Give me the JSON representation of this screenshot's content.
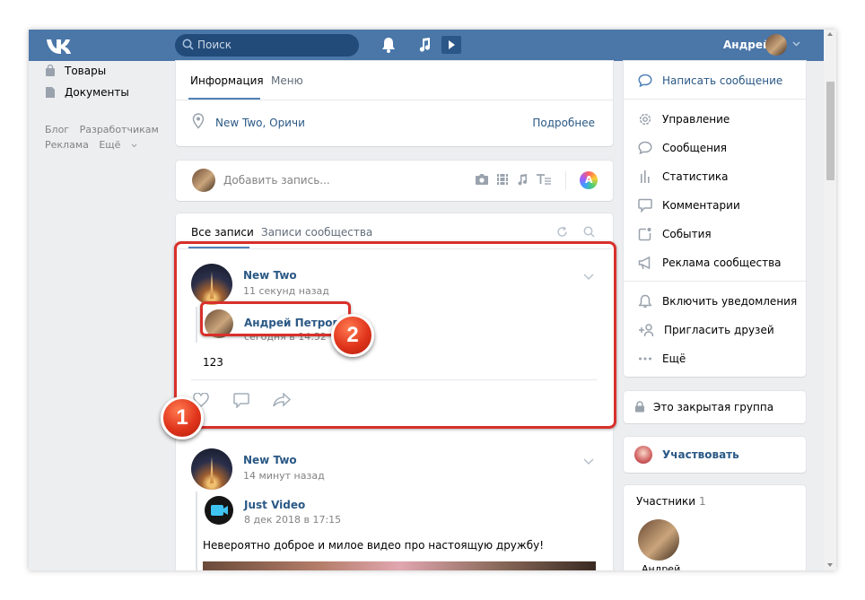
{
  "header": {
    "search_placeholder": "Поиск",
    "user_name": "Андрей",
    "icons": [
      "vk-logo-icon",
      "search-icon",
      "bell-icon",
      "music-icon",
      "video-icon",
      "chevron-down-icon"
    ],
    "bg_color": "#4a76a8"
  },
  "left_menu": {
    "items": [
      {
        "label": "Товары",
        "icon": "bag-icon"
      },
      {
        "label": "Документы",
        "icon": "document-icon"
      }
    ],
    "links": [
      "Блог",
      "Разработчикам",
      "Реклама",
      "Ещё"
    ]
  },
  "info_card": {
    "tabs": [
      "Информация",
      "Меню"
    ],
    "location": "New Two, Оричи",
    "more_link": "Подробнее"
  },
  "post_box": {
    "placeholder": "Добавить запись..."
  },
  "wall": {
    "tabs": [
      "Все записи",
      "Записи сообщества"
    ],
    "posts": [
      {
        "author": "New Two",
        "time": "11 секунд назад",
        "repost_author": "Андрей Петров",
        "repost_time": "сегодня в 14:52",
        "text": "123"
      },
      {
        "author": "New Two",
        "time": "14 минут назад",
        "repost_author": "Just Video",
        "repost_time": "8 дек 2018 в 17:15",
        "text": "Невероятно доброе и милое видео про настоящую дружбу!"
      }
    ]
  },
  "annotations": {
    "badge_1": "1",
    "badge_2": "2",
    "color": "#d8302b"
  },
  "right_actions": {
    "primary": "Написать сообщение",
    "items": [
      {
        "label": "Управление",
        "icon": "gear-icon"
      },
      {
        "label": "Сообщения",
        "icon": "message-icon"
      },
      {
        "label": "Статистика",
        "icon": "stats-icon"
      },
      {
        "label": "Комментарии",
        "icon": "comment-icon"
      },
      {
        "label": "События",
        "icon": "event-icon"
      },
      {
        "label": "Реклама сообщества",
        "icon": "megaphone-icon"
      }
    ],
    "items2": [
      {
        "label": "Включить уведомления",
        "icon": "bell-icon"
      },
      {
        "label": "Пригласить друзей",
        "icon": "add-user-icon"
      },
      {
        "label": "Ещё",
        "icon": "more-icon"
      }
    ]
  },
  "closed_group": "Это закрытая группа",
  "join": "Участвовать",
  "members": {
    "title": "Участники",
    "count": "1",
    "first_name": "Андрей"
  }
}
